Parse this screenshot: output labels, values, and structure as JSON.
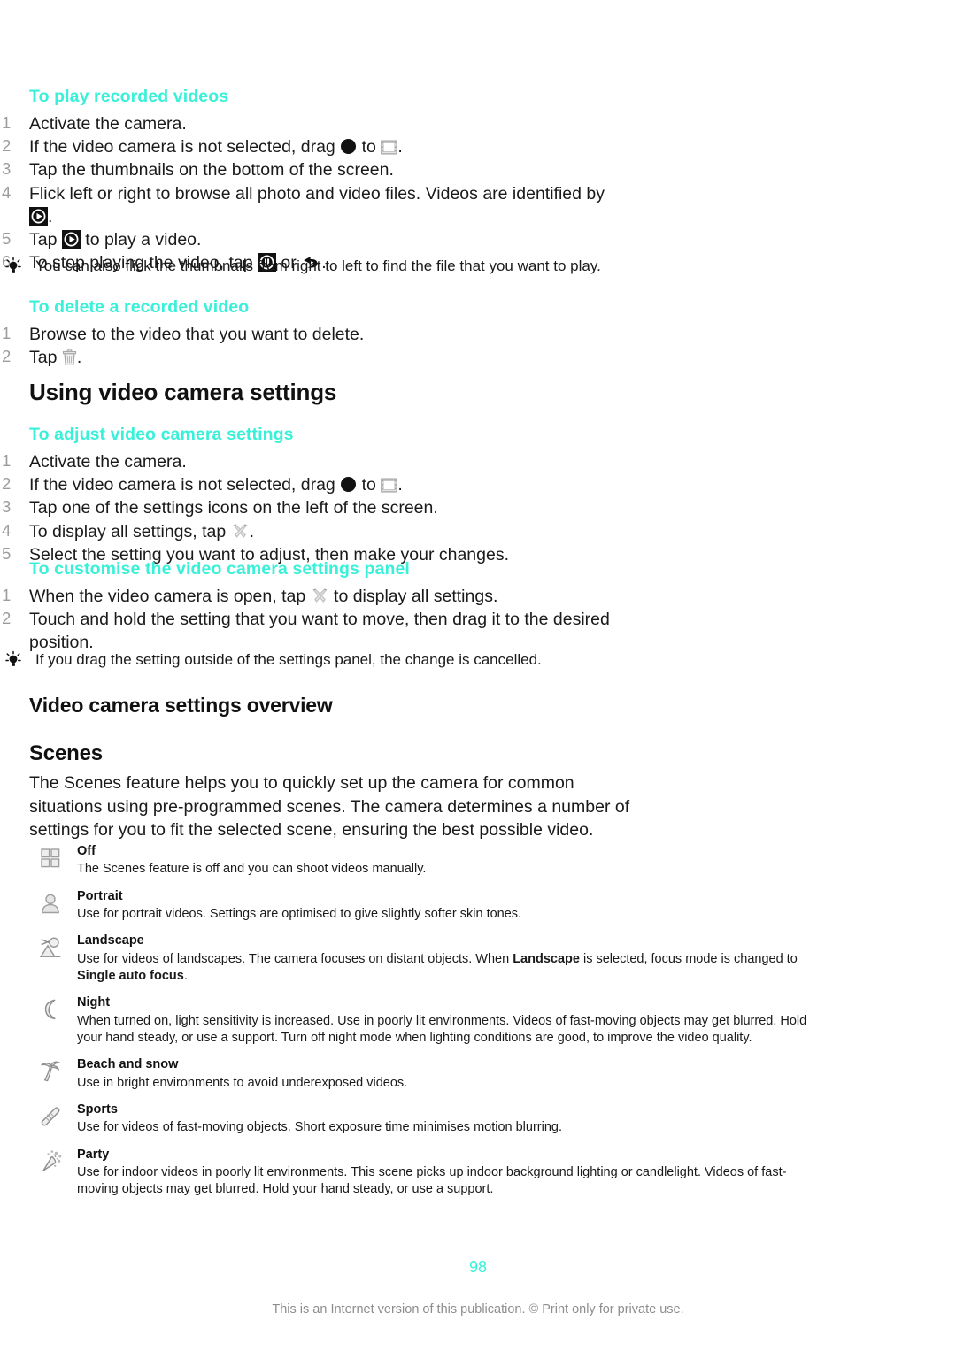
{
  "document": {
    "page_number": "98",
    "footer_note": "This is an Internet version of this publication. © Print only for private use."
  },
  "sections": {
    "play_videos": {
      "title": "To play recorded videos",
      "steps": [
        {
          "pre": "Activate the camera.",
          "icons": []
        },
        {
          "pre": "If the video camera is not selected, drag ",
          "mid": " to ",
          "post": ".",
          "icons": [
            "dot-icon",
            "film-strip-icon"
          ]
        },
        {
          "pre": "Tap the thumbnails on the bottom of the screen.",
          "icons": []
        },
        {
          "pre": "Flick left or right to browse all photo and video files. Videos are identified by ",
          "post": ".",
          "icons": [
            "play-icon"
          ]
        },
        {
          "pre": "Tap ",
          "post": " to play a video.",
          "icons": [
            "play-icon"
          ]
        },
        {
          "pre": "To stop playing the video, tap ",
          "mid": " or ",
          "post": ".",
          "icons": [
            "pause-icon",
            "back-arrow-icon"
          ]
        }
      ],
      "tip": "You can also flick the thumbnails from right to left to find the file that you want to play."
    },
    "delete_video": {
      "title": "To delete a recorded video",
      "steps": [
        {
          "pre": "Browse to the video that you want to delete.",
          "icons": []
        },
        {
          "pre": "Tap ",
          "post": ".",
          "icons": [
            "trash-icon"
          ]
        }
      ]
    },
    "using_settings": {
      "heading": "Using video camera settings",
      "adjust": {
        "title": "To adjust video camera settings",
        "steps": [
          {
            "pre": "Activate the camera.",
            "icons": []
          },
          {
            "pre": "If the video camera is not selected, drag ",
            "mid": " to ",
            "post": ".",
            "icons": [
              "dot-icon",
              "film-strip-icon"
            ]
          },
          {
            "pre": "Tap one of the settings icons on the left of the screen.",
            "icons": []
          },
          {
            "pre": "To display all settings, tap ",
            "post": ".",
            "icons": [
              "tools-icon"
            ]
          },
          {
            "pre": "Select the setting you want to adjust, then make your changes.",
            "icons": []
          }
        ]
      },
      "customise": {
        "title": "To customise the video camera settings panel",
        "steps": [
          {
            "pre": "When the video camera is open, tap ",
            "post": " to display all settings.",
            "icons": [
              "tools-icon"
            ]
          },
          {
            "pre": "Touch and hold the setting that you want to move, then drag it to the desired position.",
            "icons": []
          }
        ],
        "tip": "If you drag the setting outside of the settings panel, the change is cancelled."
      }
    },
    "overview": {
      "heading": "Video camera settings overview",
      "scenes_heading": "Scenes",
      "scenes_intro": "The Scenes feature helps you to quickly set up the camera for common situations using pre-programmed scenes. The camera determines a number of settings for you to fit the selected scene, ensuring the best possible video.",
      "scenes": [
        {
          "icon": "grid-off-icon",
          "name": "Off",
          "desc": "The Scenes feature is off and you can shoot videos manually."
        },
        {
          "icon": "portrait-person-icon",
          "name": "Portrait",
          "desc": "Use for portrait videos. Settings are optimised to give slightly softer skin tones."
        },
        {
          "icon": "landscape-mountain-icon",
          "name": "Landscape",
          "desc_parts": [
            {
              "t": "Use for videos of landscapes. The camera focuses on distant objects. When ",
              "b": false
            },
            {
              "t": "Landscape",
              "b": true
            },
            {
              "t": " is selected, focus mode is changed to ",
              "b": false
            },
            {
              "t": "Single auto focus",
              "b": true
            },
            {
              "t": ".",
              "b": false
            }
          ]
        },
        {
          "icon": "night-moon-icon",
          "name": "Night",
          "desc": "When turned on, light sensitivity is increased. Use in poorly lit environments. Videos of fast-moving objects may get blurred. Hold your hand steady, or use a support. Turn off night mode when lighting conditions are good, to improve the video quality."
        },
        {
          "icon": "beach-palm-icon",
          "name": "Beach and snow",
          "desc": "Use in bright environments to avoid underexposed videos."
        },
        {
          "icon": "sports-shoe-icon",
          "name": "Sports",
          "desc": "Use for videos of fast-moving objects. Short exposure time minimises motion blurring."
        },
        {
          "icon": "party-popper-icon",
          "name": "Party",
          "desc": "Use for indoor videos in poorly lit environments. This scene picks up indoor background lighting or candlelight. Videos of fast-moving objects may get blurred. Hold your hand steady, or use a support."
        }
      ]
    }
  },
  "colors": {
    "accent": "#39f0d8",
    "text": "#1a1a1a",
    "muted": "#8d8d8d"
  }
}
